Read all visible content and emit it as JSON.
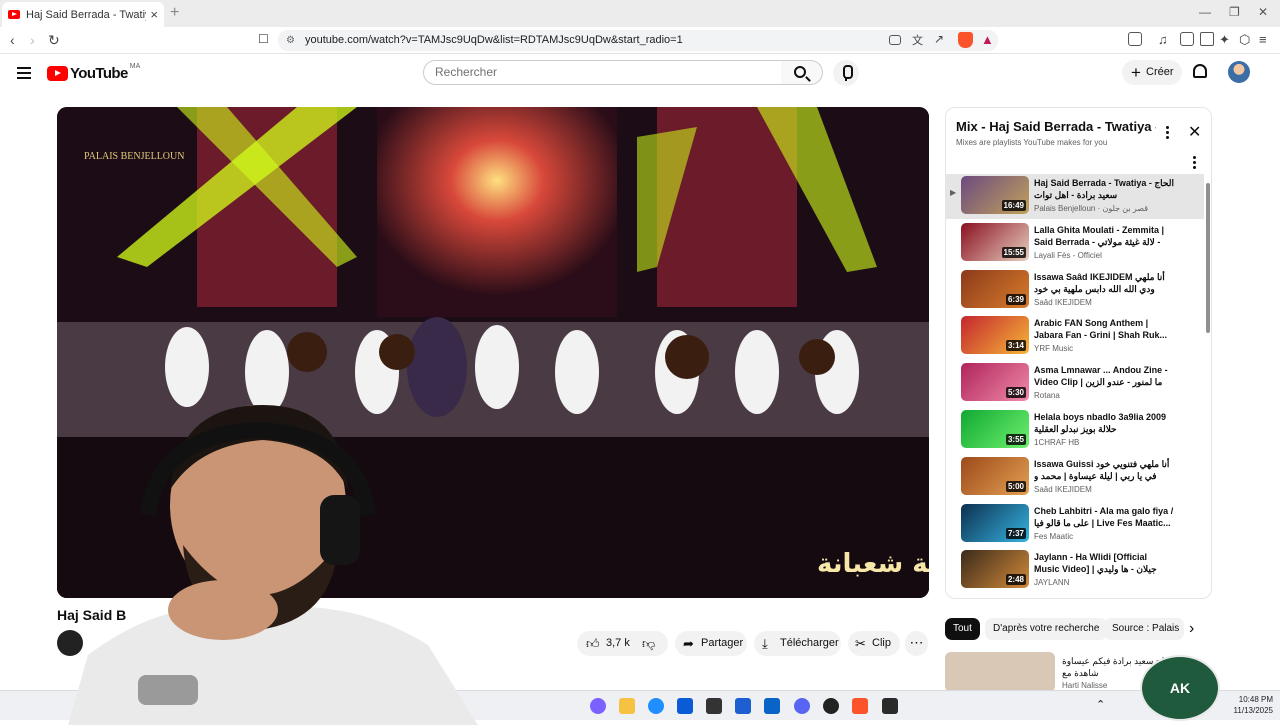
{
  "browser": {
    "tab_title": "Haj Said Berrada - Twatiya - ...",
    "tab_close": "×",
    "new_tab": "+",
    "url": "youtube.com/watch?v=TAMJsc9UqDw&list=RDTAMJsc9UqDw&start_radio=1",
    "window_controls": [
      "—",
      "❐",
      "✕"
    ]
  },
  "youtube": {
    "logo_text": "YouTube",
    "country_code": "MA",
    "search_placeholder": "Rechercher",
    "create_label": "Créer"
  },
  "video": {
    "title": "Haj Said B",
    "overlay_brand": "PALAIS BENJELLOUN",
    "overlay_arabic": "ليلة شعبانة",
    "actions": {
      "likes": "3,7 k",
      "share": "Partager",
      "download": "Télécharger",
      "clip": "Clip"
    }
  },
  "playlist": {
    "title": "Mix - Haj Said Berrada - Twatiya - الحاج سعيد برادة",
    "subtitle": "Mixes are playlists YouTube makes for you",
    "items": [
      {
        "title": "Haj Said Berrada - Twatiya - الحاج سعيد برادة - اهل توات",
        "channel": "Palais Benjelloun · قصر بن جلون",
        "duration": "16:49",
        "active": true,
        "colors": [
          "#6b4a80",
          "#c2a25a"
        ]
      },
      {
        "title": "Lalla Ghita Moulati - Zemmita | Said Berrada - لالة غيثة مولاتي -",
        "channel": "Layali Fès - Officiel",
        "duration": "15:55",
        "active": false,
        "colors": [
          "#8a1020",
          "#e8d0c0"
        ]
      },
      {
        "title": "Issawa Saâd IKEJIDEM أنا ملهي ودي الله الله دابس ملهية بي خود حقي يا رب",
        "channel": "Saâd IKEJIDEM",
        "duration": "6:39",
        "active": false,
        "colors": [
          "#8b3a1a",
          "#d97c2c"
        ]
      },
      {
        "title": "Arabic FAN Song Anthem | Jabara Fan - Grini | Shah Ruk...",
        "channel": "YRF Music",
        "duration": "3:14",
        "active": false,
        "colors": [
          "#c4262e",
          "#f5b638"
        ]
      },
      {
        "title": "Asma Lmnawar ... Andou Zine - Video Clip | ما لمنور - عندو الزين",
        "channel": "Rotana",
        "duration": "5:30",
        "active": false,
        "colors": [
          "#b0245c",
          "#f08aa8"
        ]
      },
      {
        "title": "Helala boys nbadlo 3a9lia 2009 حلالة بويز نبدلو العقلية",
        "channel": "1CHRAF HB",
        "duration": "3:55",
        "active": false,
        "colors": [
          "#11a832",
          "#6ef06e"
        ]
      },
      {
        "title": "Issawa Guissi أنا ملهي فتنويي خود في يا ربي | ليلة عيساوة | محمد و الطاهر",
        "channel": "Saâd IKEJIDEM",
        "duration": "5:00",
        "active": false,
        "colors": [
          "#9c4a1a",
          "#e3a052"
        ]
      },
      {
        "title": "Cheb Lahbitri - Ala ma galo fiya / على ما قالو فيا | Live Fes Maatic...",
        "channel": "Fes Maatic",
        "duration": "7:37",
        "active": false,
        "colors": [
          "#0d3050",
          "#36b3e0"
        ]
      },
      {
        "title": "Jaylann - Ha Wlidi [Official Music Video] | جيلان - ها وليدي",
        "channel": "JAYLANN",
        "duration": "2:48",
        "active": false,
        "colors": [
          "#3a2a1a",
          "#d38a3a"
        ]
      }
    ]
  },
  "chips": [
    "Tout",
    "D'après votre recherche",
    "Source : Palais"
  ],
  "recommendation": {
    "title": "الحاج سعيد برادة فيكم عيساوة شاهدة مع",
    "channel": "Harti Nalisse"
  },
  "taskbar": {
    "time": "10:48 PM",
    "date": "11/13/2025"
  },
  "streamer_logo": "AK"
}
